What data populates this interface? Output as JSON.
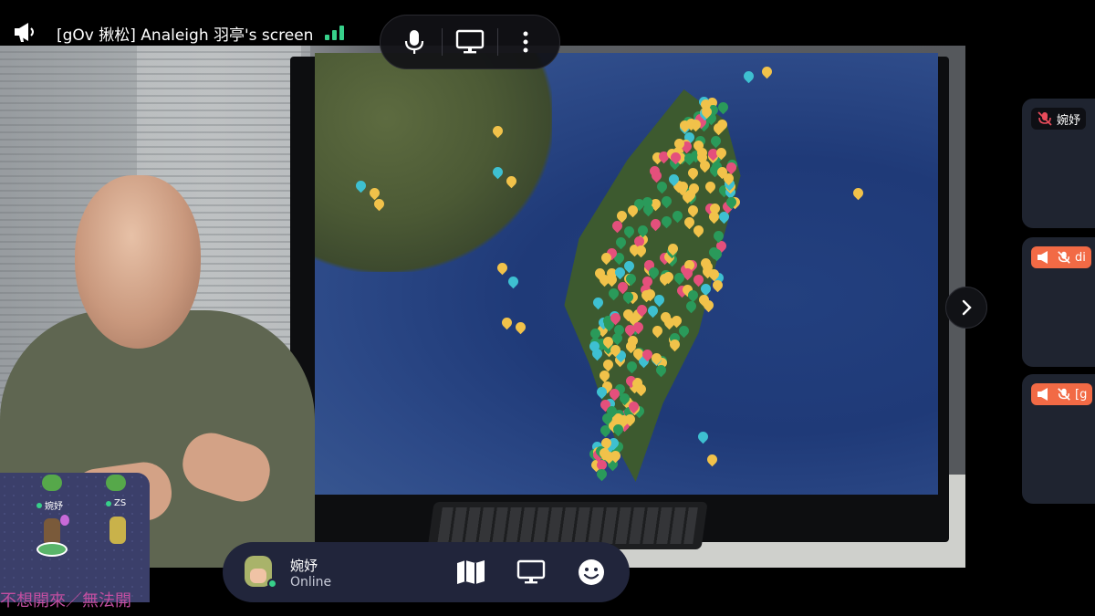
{
  "topbar": {
    "title": "[gOv 揪松] Analeigh 羽亭's screen"
  },
  "participants": [
    {
      "label": "婉妤",
      "style": "dark",
      "icons": [
        "mic-off-icon"
      ]
    },
    {
      "label": "di",
      "style": "orange",
      "icons": [
        "megaphone-icon",
        "mic-off-icon"
      ]
    },
    {
      "label": "[g",
      "style": "orange",
      "icons": [
        "megaphone-icon",
        "mic-off-icon"
      ]
    }
  ],
  "minimap": {
    "player_name": "婉妤",
    "other_name": "ZS"
  },
  "subtitle": "不想開來／無法開",
  "me": {
    "name": "婉妤",
    "status": "Online"
  },
  "colors": {
    "online": "#37d08a",
    "accent_orange": "#f26a45",
    "bar_bg": "#21253b"
  }
}
